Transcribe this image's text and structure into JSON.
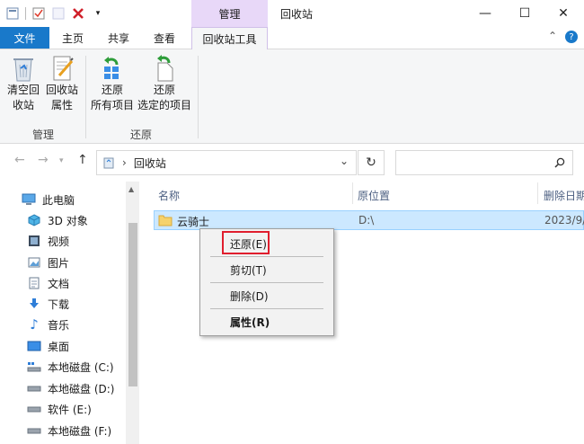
{
  "window": {
    "title": "回收站",
    "context_tab_header": "管理",
    "min_glyph": "—",
    "max_glyph": "☐",
    "close_glyph": "✕"
  },
  "ribbon_tabs": {
    "file": "文件",
    "home": "主页",
    "share": "共享",
    "view": "查看",
    "recycle_tools": "回收站工具",
    "collapse_glyph": "⌃",
    "help_glyph": "?"
  },
  "ribbon": {
    "empty_line1": "清空回",
    "empty_line2": "收站",
    "props_line1": "回收站",
    "props_line2": "属性",
    "restore_all_line1": "还原",
    "restore_all_line2": "所有项目",
    "restore_sel_line1": "还原",
    "restore_sel_line2": "选定的项目",
    "group_manage": "管理",
    "group_restore": "还原"
  },
  "address": {
    "path": "回收站",
    "separator": "›",
    "search_placeholder": ""
  },
  "nav": {
    "items": [
      {
        "label": "此电脑"
      },
      {
        "label": "3D 对象"
      },
      {
        "label": "视频"
      },
      {
        "label": "图片"
      },
      {
        "label": "文档"
      },
      {
        "label": "下载"
      },
      {
        "label": "音乐"
      },
      {
        "label": "桌面"
      },
      {
        "label": "本地磁盘 (C:)"
      },
      {
        "label": "本地磁盘 (D:)"
      },
      {
        "label": "软件 (E:)"
      },
      {
        "label": "本地磁盘 (F:)"
      }
    ]
  },
  "columns": {
    "name": "名称",
    "original_location": "原位置",
    "date_deleted": "删除日期"
  },
  "files": [
    {
      "name": "云骑士",
      "location": "D:\\",
      "date": "2023/9/"
    }
  ],
  "context_menu": {
    "restore": "还原(E)",
    "cut": "剪切(T)",
    "delete": "删除(D)",
    "properties": "属性(R)"
  }
}
